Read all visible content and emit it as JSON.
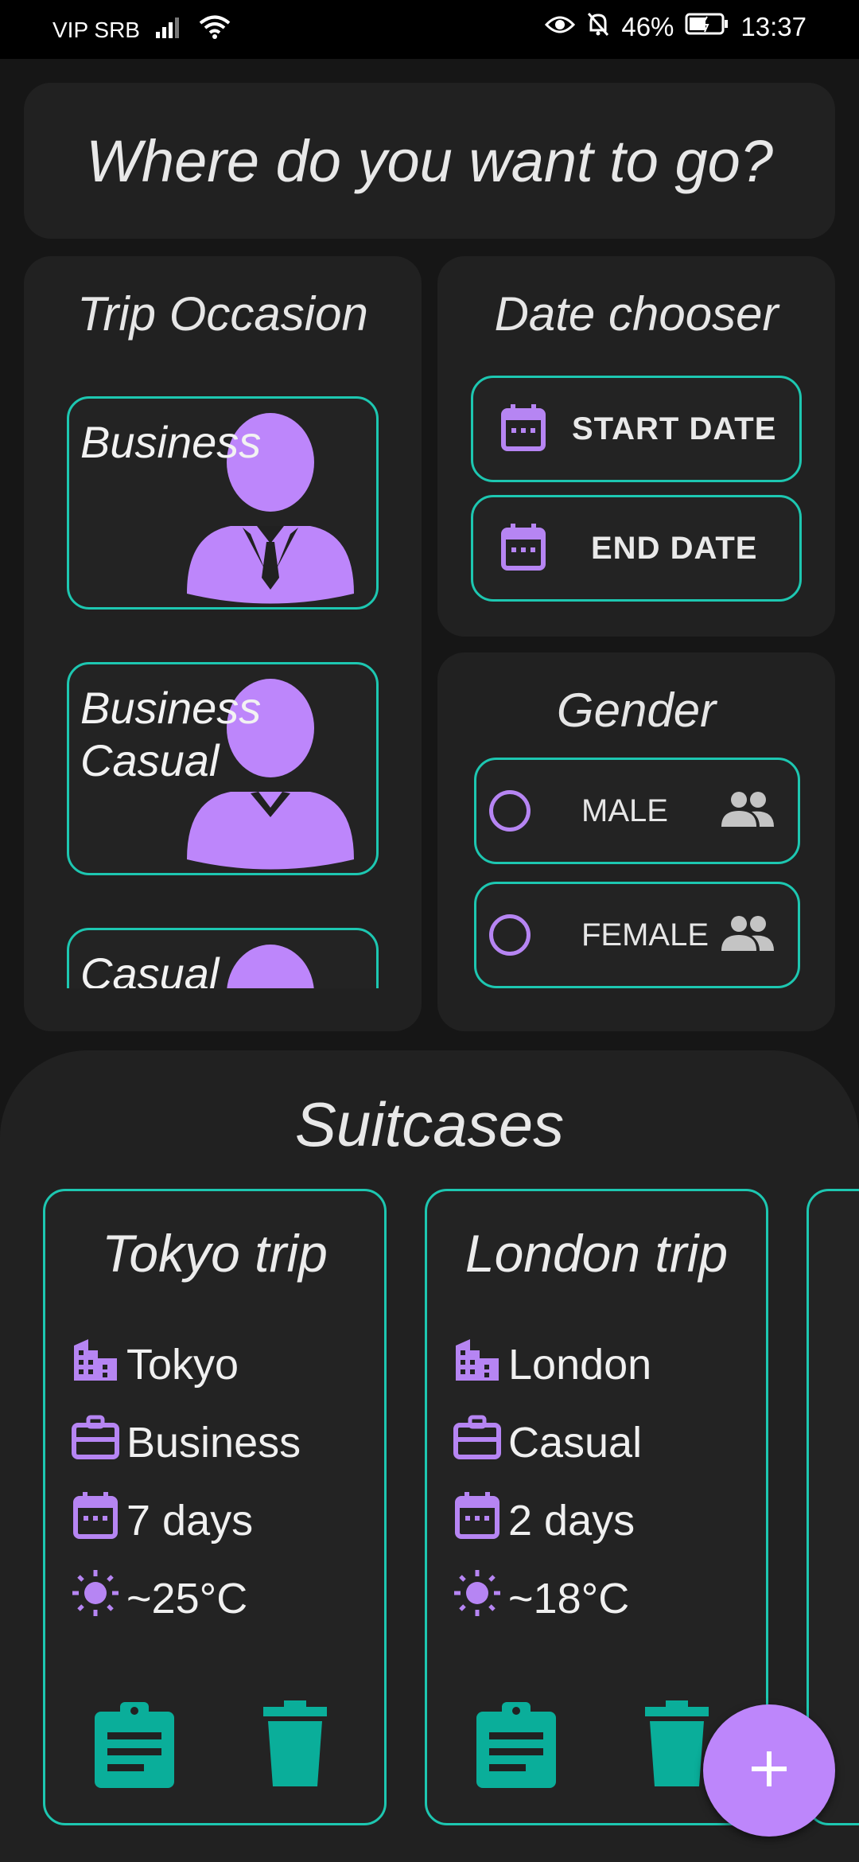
{
  "status_bar": {
    "carrier": "VIP SRB",
    "battery": "46%",
    "time": "13:37"
  },
  "question": "Where do you want to go?",
  "trip_occasion": {
    "title": "Trip Occasion",
    "options": [
      {
        "label": "Business"
      },
      {
        "label": "Business Casual"
      },
      {
        "label": "Casual"
      }
    ]
  },
  "date_chooser": {
    "title": "Date chooser",
    "start_label": "START DATE",
    "end_label": "END DATE"
  },
  "gender": {
    "title": "Gender",
    "male_label": "MALE",
    "female_label": "FEMALE"
  },
  "suitcases": {
    "title": "Suitcases",
    "items": [
      {
        "title": "Tokyo trip",
        "city": "Tokyo",
        "occasion": "Business",
        "duration": "7 days",
        "temperature": "~25°C"
      },
      {
        "title": "London trip",
        "city": "London",
        "occasion": "Casual",
        "duration": "2 days",
        "temperature": "~18°C"
      }
    ]
  },
  "colors": {
    "accent": "#1dc7b1",
    "purple": "#b685f3",
    "background": "#161616",
    "card": "#212121",
    "teal_icon": "#0aae9a"
  },
  "icons": [
    "eye-icon",
    "bell-off-icon",
    "battery-icon",
    "signal-icon",
    "wifi-icon",
    "calendar-icon",
    "people-icon",
    "building-icon",
    "briefcase-icon",
    "sun-icon",
    "clipboard-icon",
    "trash-icon",
    "plus-icon",
    "person-icon"
  ]
}
